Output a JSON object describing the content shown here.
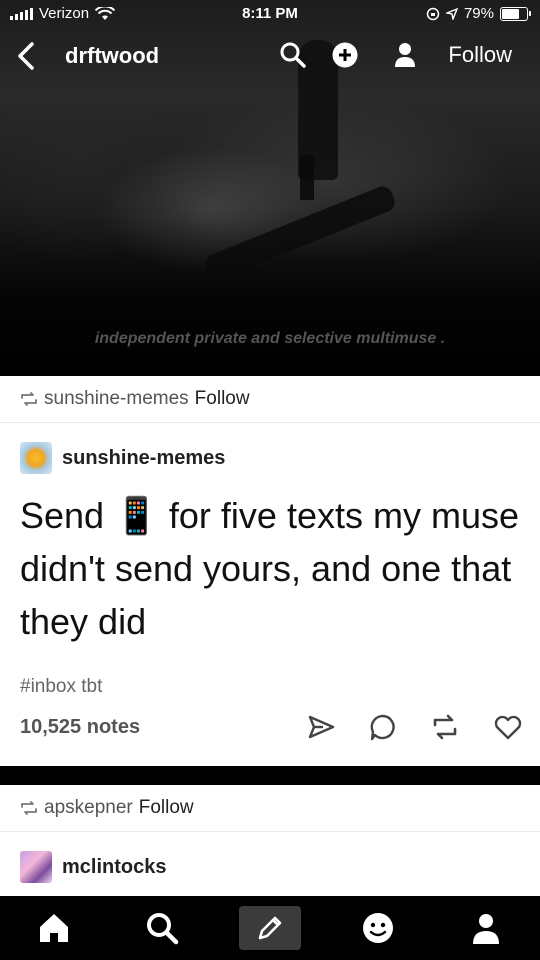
{
  "status_bar": {
    "carrier": "Verizon",
    "time": "8:11 PM",
    "battery": "79%",
    "battery_level": 0.79
  },
  "nav": {
    "blog_name": "drftwood",
    "follow_label": "Follow"
  },
  "header": {
    "tagline": "independent private and selective multimuse ."
  },
  "post1": {
    "reblogged_from": "sunshine-memes",
    "reblog_follow": "Follow",
    "author": "sunshine-memes",
    "body": "Send 📱 for five texts my muse didn't send yours, and one that they did",
    "tags": "#inbox tbt",
    "notes": "10,525 notes"
  },
  "post2": {
    "reblogged_from": "apskepner",
    "reblog_follow": "Follow",
    "author": "mclintocks"
  },
  "icons": {
    "nav": [
      "back-icon",
      "search-icon",
      "add-icon",
      "person-icon"
    ],
    "actions": [
      "share-icon",
      "reply-icon",
      "reblog-icon",
      "like-icon"
    ],
    "tabs": [
      "home-icon",
      "search-icon",
      "compose-icon",
      "activity-icon",
      "account-icon"
    ]
  }
}
